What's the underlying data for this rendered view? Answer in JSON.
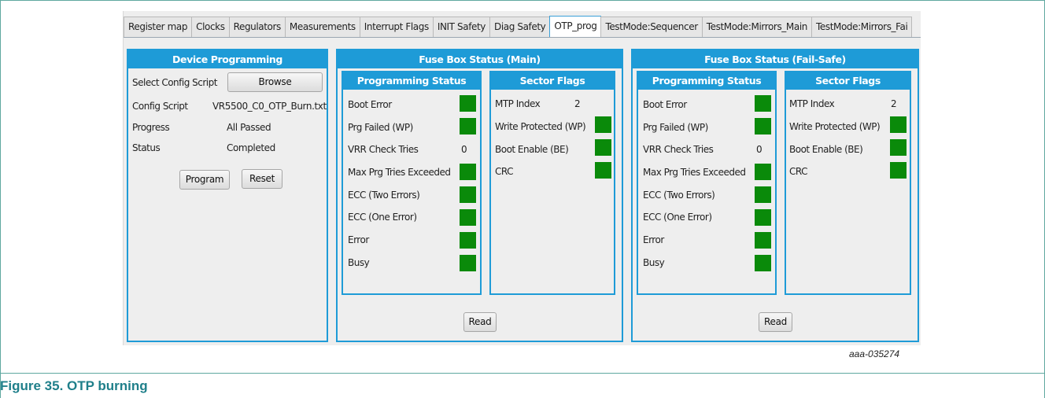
{
  "tabs": [
    "Register map",
    "Clocks",
    "Regulators",
    "Measurements",
    "Interrupt Flags",
    "INIT Safety",
    "Diag Safety",
    "OTP_prog",
    "TestMode:Sequencer",
    "TestMode:Mirrors_Main",
    "TestMode:Mirrors_Fai"
  ],
  "active_tab": "OTP_prog",
  "device": {
    "title": "Device Programming",
    "select_label": "Select Config Script",
    "browse_label": "Browse",
    "config_label": "Config Script",
    "config_value": "VR5500_C0_OTP_Burn.txt",
    "progress_label": "Progress",
    "progress_value": "All Passed",
    "status_label": "Status",
    "status_value": "Completed",
    "program_label": "Program",
    "reset_label": "Reset"
  },
  "main": {
    "title": "Fuse Box Status (Main)",
    "prog_title": "Programming Status",
    "prog_rows": [
      {
        "label": "Boot Error",
        "value": "",
        "led": true
      },
      {
        "label": "Prg Failed (WP)",
        "value": "",
        "led": true
      },
      {
        "label": "VRR Check Tries",
        "value": "0",
        "led": false
      },
      {
        "label": "Max Prg Tries Exceeded",
        "value": "",
        "led": true
      },
      {
        "label": "ECC (Two Errors)",
        "value": "",
        "led": true
      },
      {
        "label": "ECC (One Error)",
        "value": "",
        "led": true
      },
      {
        "label": "Error",
        "value": "",
        "led": true
      },
      {
        "label": "Busy",
        "value": "",
        "led": true
      }
    ],
    "sector_title": "Sector Flags",
    "sector_rows": [
      {
        "label": "MTP Index",
        "value": "2",
        "led": false
      },
      {
        "label": "Write Protected (WP)",
        "value": "",
        "led": true
      },
      {
        "label": "Boot Enable (BE)",
        "value": "",
        "led": true
      },
      {
        "label": "CRC",
        "value": "",
        "led": true
      }
    ],
    "read_label": "Read"
  },
  "failsafe": {
    "title": "Fuse Box Status (Fail-Safe)",
    "prog_title": "Programming Status",
    "prog_rows": [
      {
        "label": "Boot Error",
        "value": "",
        "led": true
      },
      {
        "label": "Prg Failed (WP)",
        "value": "",
        "led": true
      },
      {
        "label": "VRR Check Tries",
        "value": "0",
        "led": false
      },
      {
        "label": "Max Prg Tries Exceeded",
        "value": "",
        "led": true
      },
      {
        "label": "ECC (Two Errors)",
        "value": "",
        "led": true
      },
      {
        "label": "ECC (One Error)",
        "value": "",
        "led": true
      },
      {
        "label": "Error",
        "value": "",
        "led": true
      },
      {
        "label": "Busy",
        "value": "",
        "led": true
      }
    ],
    "sector_title": "Sector Flags",
    "sector_rows": [
      {
        "label": "MTP Index",
        "value": "2",
        "led": false
      },
      {
        "label": "Write Protected (WP)",
        "value": "",
        "led": true
      },
      {
        "label": "Boot Enable (BE)",
        "value": "",
        "led": true
      },
      {
        "label": "CRC",
        "value": "",
        "led": true
      }
    ],
    "read_label": "Read"
  },
  "led_color": "#0a8a0a",
  "accent_color": "#1e9bd7",
  "figure_ref": "aaa-035274",
  "caption": "Figure 35.  OTP burning"
}
